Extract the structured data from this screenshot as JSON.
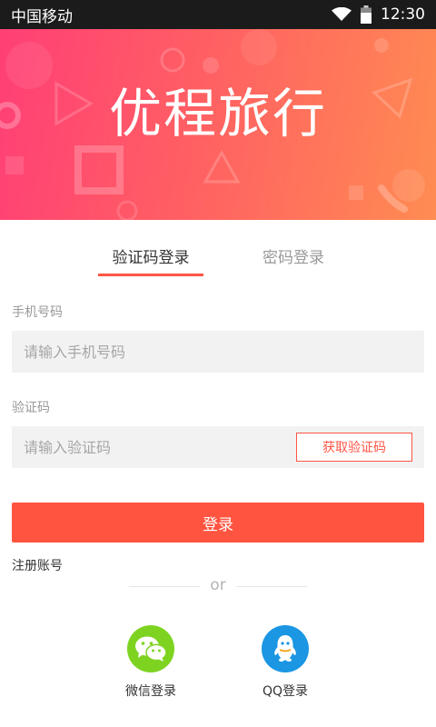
{
  "status_bar": {
    "carrier": "中国移动",
    "time": "12:30"
  },
  "banner": {
    "logo_text": "优程旅行",
    "gradient_start": "#ff3f76",
    "gradient_end": "#ff8c52"
  },
  "tabs": [
    {
      "label": "验证码登录",
      "active": true
    },
    {
      "label": "密码登录",
      "active": false
    }
  ],
  "form": {
    "phone_label": "手机号码",
    "phone_placeholder": "请输入手机号码",
    "code_label": "验证码",
    "code_placeholder": "请输入验证码",
    "get_code_label": "获取验证码",
    "login_label": "登录"
  },
  "register_label": "注册账号",
  "divider_text": "or",
  "social": {
    "wechat_label": "微信登录",
    "qq_label": "QQ登录"
  },
  "colors": {
    "accent": "#ff5440",
    "wechat": "#7ed321",
    "qq": "#1a96e3"
  }
}
